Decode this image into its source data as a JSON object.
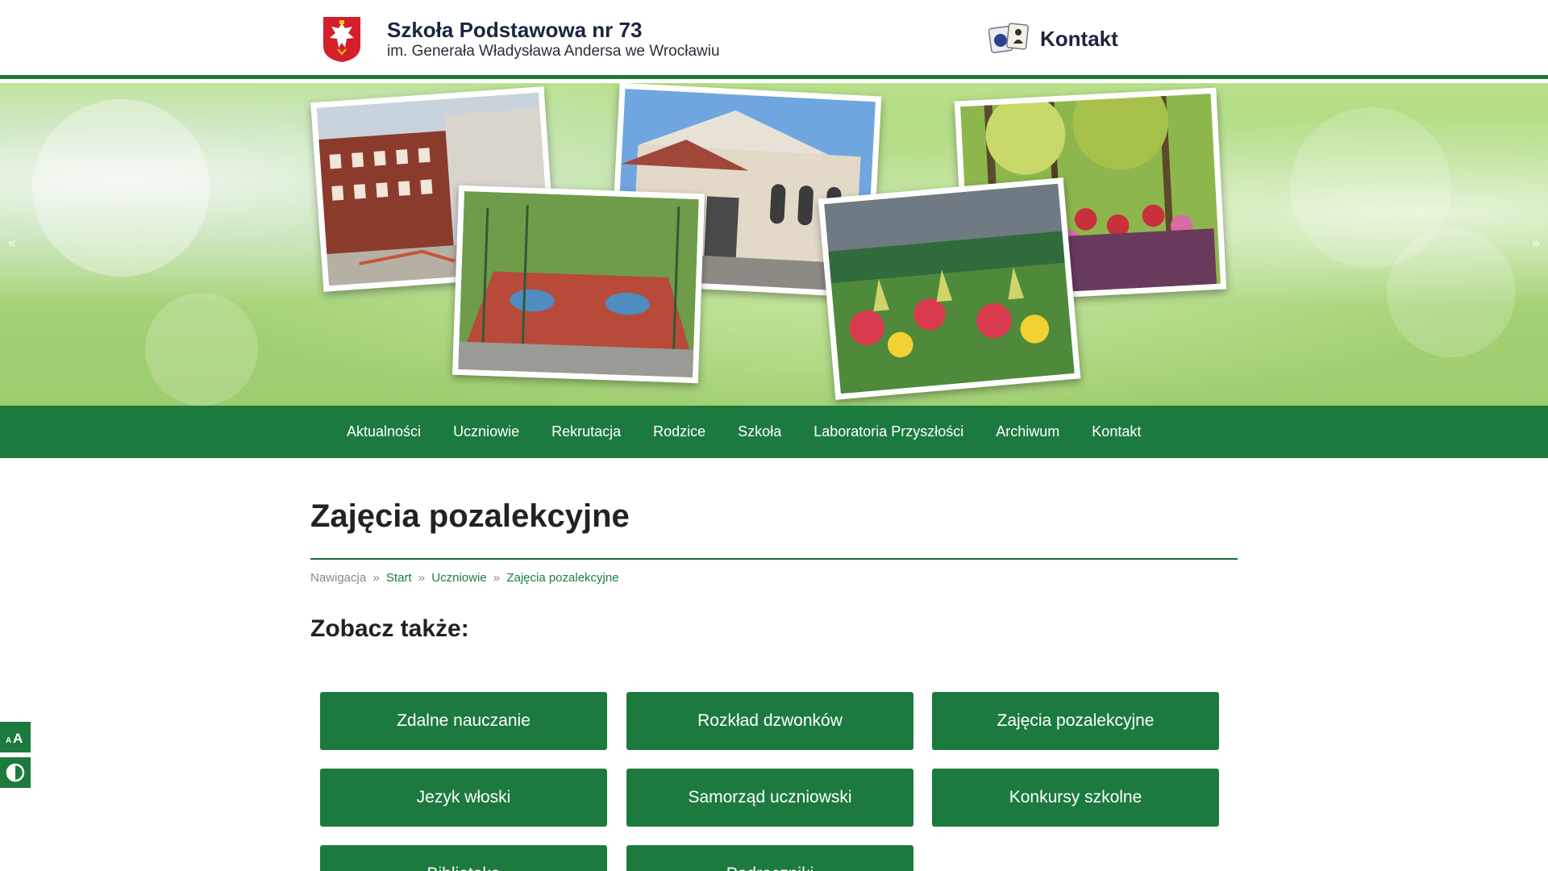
{
  "header": {
    "school_name": "Szkoła Podstawowa nr 73",
    "school_subtitle": "im. Generała Władysława Andersa we Wrocławiu",
    "contact_label": "Kontakt"
  },
  "banner": {
    "prev_arrow": "«",
    "next_arrow": "»"
  },
  "nav": {
    "items": [
      {
        "label": "Aktualności"
      },
      {
        "label": "Uczniowie"
      },
      {
        "label": "Rekrutacja"
      },
      {
        "label": "Rodzice"
      },
      {
        "label": "Szkoła"
      },
      {
        "label": "Laboratoria Przyszłości"
      },
      {
        "label": "Archiwum"
      },
      {
        "label": "Kontakt"
      }
    ]
  },
  "main": {
    "page_title": "Zajęcia pozalekcyjne",
    "breadcrumb": {
      "prefix": "Nawigacja",
      "separator": "»",
      "items": [
        "Start",
        "Uczniowie",
        "Zajęcia pozalekcyjne"
      ]
    },
    "see_also_heading": "Zobacz także:",
    "tiles": [
      {
        "label": "Zdalne nauczanie"
      },
      {
        "label": "Rozkład dzwonków"
      },
      {
        "label": "Zajęcia pozalekcyjne"
      },
      {
        "label": "Jezyk włoski"
      },
      {
        "label": "Samorząd uczniowski"
      },
      {
        "label": "Konkursy szkolne"
      },
      {
        "label": "Biblioteka"
      },
      {
        "label": "Podręczniki"
      }
    ]
  },
  "accessibility": {
    "font_size_icon": "font-size-icon",
    "contrast_icon": "contrast-icon"
  },
  "colors": {
    "brand_green": "#1d7a3e",
    "header_text": "#1b2540"
  }
}
